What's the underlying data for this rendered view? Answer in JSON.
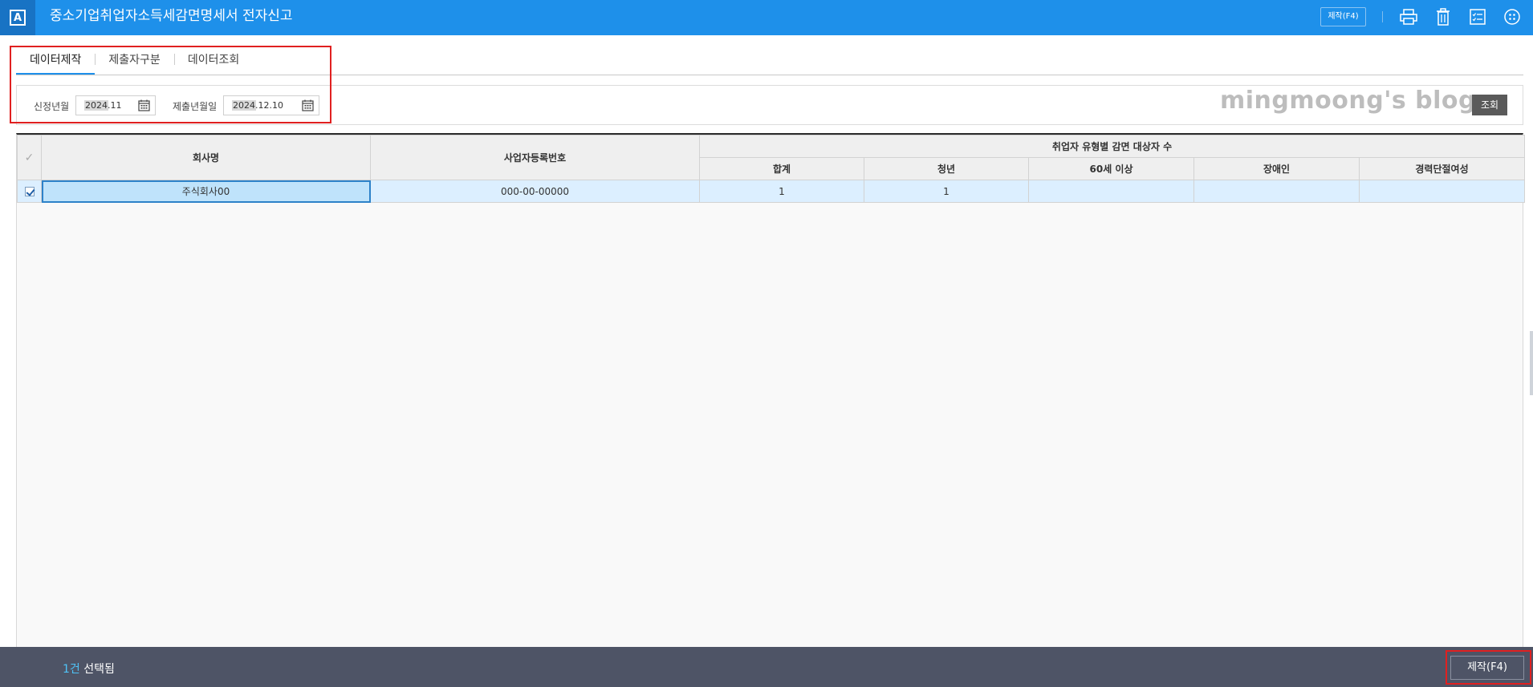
{
  "titlebar": {
    "logo_letter": "A",
    "title": "중소기업취업자소득세감면명세서 전자신고",
    "make_button": "제작(F4)",
    "icons": [
      "print-icon",
      "trash-icon",
      "checklist-icon",
      "grid-menu-icon"
    ]
  },
  "tabs": [
    {
      "label": "데이터제작",
      "active": true
    },
    {
      "label": "제출자구분",
      "active": false
    },
    {
      "label": "데이터조회",
      "active": false
    }
  ],
  "filter": {
    "apply_month_label": "신정년월",
    "apply_month_value": "2024.11",
    "submit_date_label": "제출년월일",
    "submit_date_value": "2024.12.10",
    "search_button": "조회"
  },
  "watermark": "mingmoong's blog",
  "grid": {
    "header_check": "✓",
    "col_company": "회사명",
    "col_bizno": "사업자등록번호",
    "group_header": "취업자 유형별 감면 대상자 수",
    "sub_headers": [
      "합계",
      "청년",
      "60세 이상",
      "장애인",
      "경력단절여성"
    ],
    "rows": [
      {
        "checked": true,
        "company": "주식회사00",
        "bizno": "000-00-00000",
        "total": "1",
        "youth": "1",
        "over60": "",
        "disabled": "",
        "career_break": ""
      }
    ]
  },
  "footer": {
    "count_num": "1건",
    "count_text": " 선택됨",
    "make_button": "제작(F4)"
  },
  "colors": {
    "titlebar": "#1e90ea",
    "tab_active": "#1e90ea",
    "bottombar": "#4e5466",
    "selected_row": "#dcefff",
    "annotation": "#e02020"
  }
}
